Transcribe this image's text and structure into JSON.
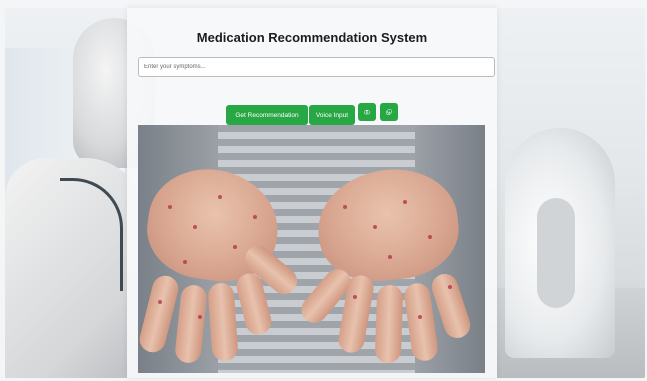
{
  "app": {
    "title": "Medication Recommendation System"
  },
  "search": {
    "placeholder": "Enter your symptoms...",
    "value": ""
  },
  "buttons": {
    "get_recommendation": "Get Recommendation",
    "voice_input": "Voice Input",
    "camera_icon": "camera-icon",
    "gallery_icon": "gallery-icon"
  },
  "colors": {
    "button_green": "#28a745",
    "title_text": "#1d1d1d"
  },
  "image": {
    "description_icon": "uploaded-hands-photo"
  }
}
